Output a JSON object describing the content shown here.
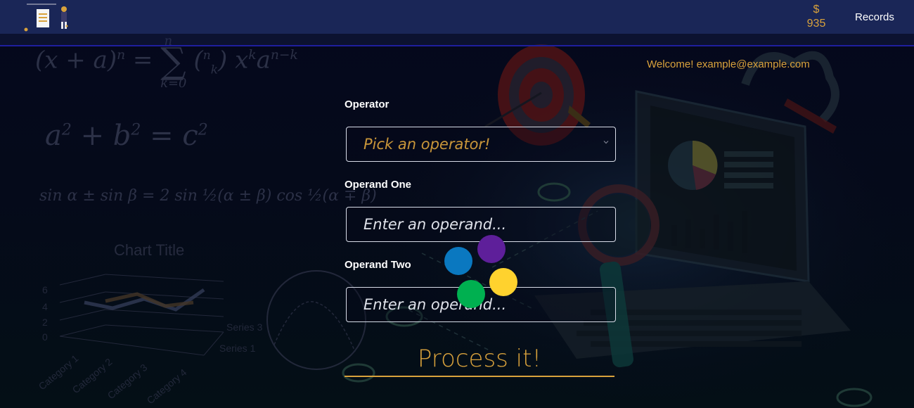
{
  "header": {
    "balance_currency": "$",
    "balance_amount": "935",
    "records_link": "Records"
  },
  "welcome": "Welcome! example@example.com",
  "form": {
    "operator_label": "Operator",
    "operator_placeholder": "Pick an operator!",
    "operand_one_label": "Operand One",
    "operand_one_placeholder": "Enter an operand...",
    "operand_two_label": "Operand Two",
    "operand_two_placeholder": "Enter an operand...",
    "submit_label": "Process it!"
  },
  "loader_dots": [
    {
      "color": "#0a78c0"
    },
    {
      "color": "#5e1f9a"
    },
    {
      "color": "#00b050"
    },
    {
      "color": "#ffd22e"
    }
  ],
  "background": {
    "chart_title": "Chart Title",
    "chart_y_ticks": [
      "6",
      "4",
      "2",
      "0"
    ],
    "chart_series": [
      "Series 3",
      "Series 1"
    ],
    "chart_categories": [
      "Category 1",
      "Category 2",
      "Category 3",
      "Category 4"
    ]
  },
  "colors": {
    "accent": "#d9a23c",
    "topbar": "#1a2657",
    "background": "#05081d"
  }
}
